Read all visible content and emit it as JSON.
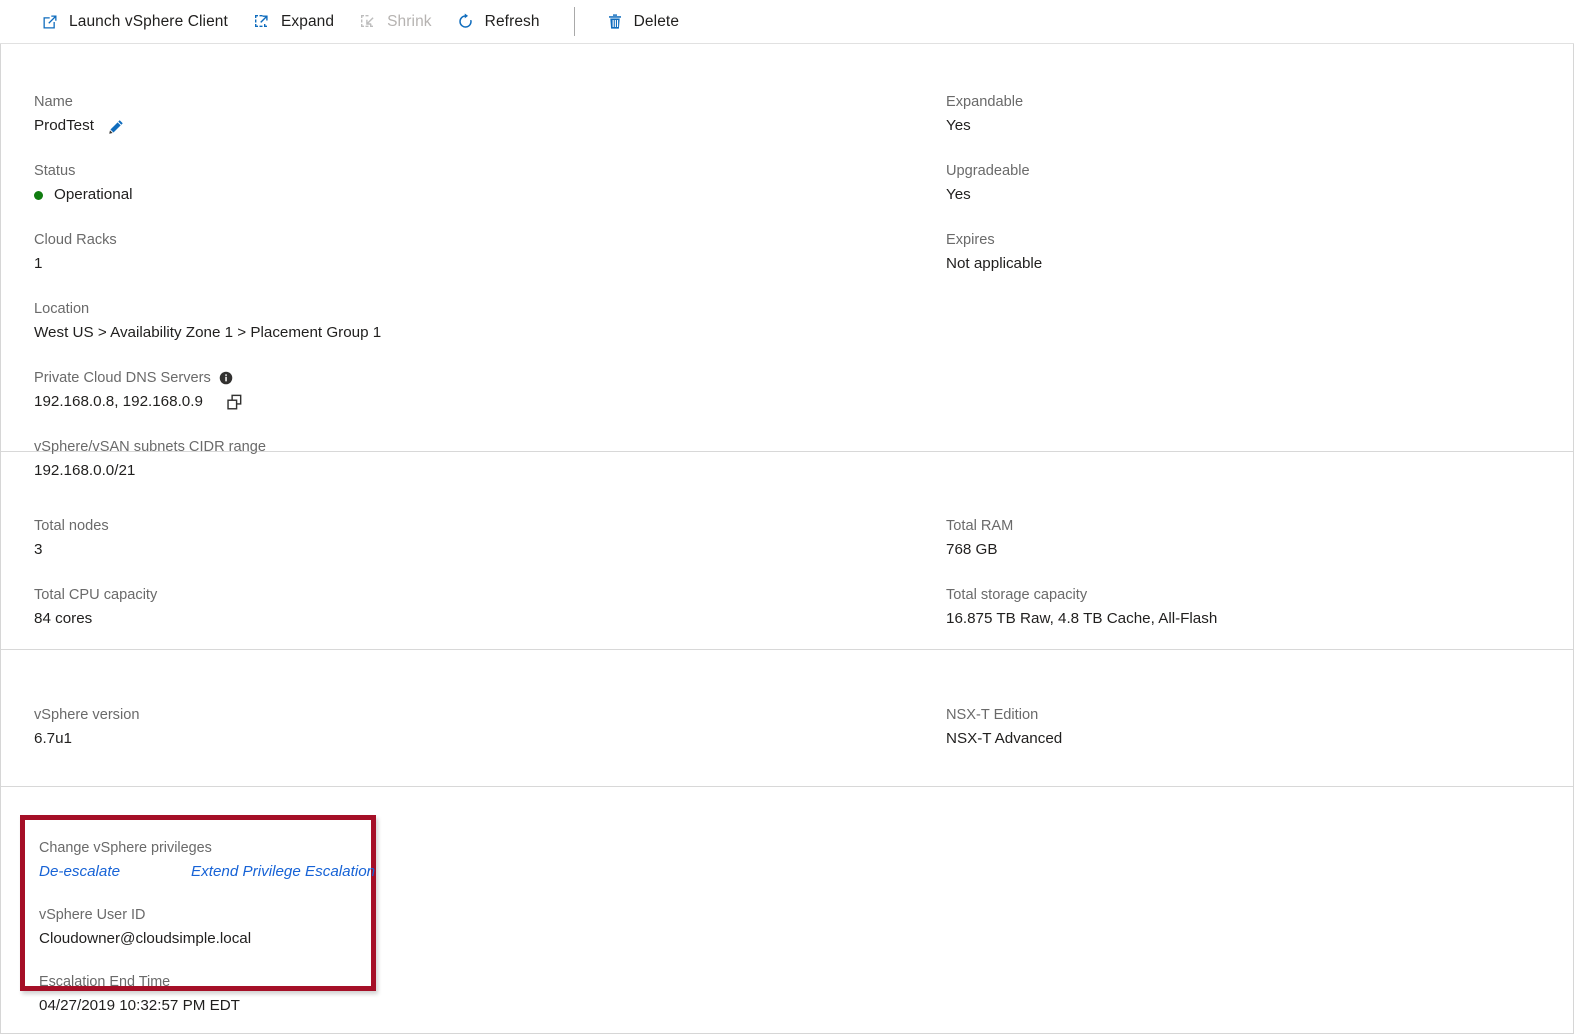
{
  "toolbar": {
    "buttons": [
      {
        "id": "launch-vsphere-client",
        "label": "Launch vSphere Client",
        "icon": "external-link-icon",
        "disabled": false
      },
      {
        "id": "expand",
        "label": "Expand",
        "icon": "expand-icon",
        "disabled": false
      },
      {
        "id": "shrink",
        "label": "Shrink",
        "icon": "shrink-icon",
        "disabled": true
      },
      {
        "id": "refresh",
        "label": "Refresh",
        "icon": "refresh-icon",
        "disabled": false
      },
      {
        "id": "delete",
        "label": "Delete",
        "icon": "trash-icon",
        "disabled": false
      }
    ]
  },
  "colors": {
    "accent": "#0f6cbd",
    "link": "#1763d6",
    "status_ok": "#107c10",
    "highlight_border": "#a50f27",
    "disabled_text": "#b6b3b1",
    "label_text": "#6a6a6a",
    "value_text": "#201f1e"
  },
  "overview": {
    "left": {
      "name": {
        "label": "Name",
        "value": "ProdTest"
      },
      "status": {
        "label": "Status",
        "value": "Operational"
      },
      "cloud_racks": {
        "label": "Cloud Racks",
        "value": "1"
      },
      "location": {
        "label": "Location",
        "value": "West US > Availability Zone 1 > Placement Group 1"
      },
      "dns_servers": {
        "label": "Private Cloud DNS Servers",
        "value": "192.168.0.8, 192.168.0.9"
      },
      "cidr_range": {
        "label": "vSphere/vSAN subnets CIDR range",
        "value": "192.168.0.0/21"
      }
    },
    "right": {
      "expandable": {
        "label": "Expandable",
        "value": "Yes"
      },
      "upgradeable": {
        "label": "Upgradeable",
        "value": "Yes"
      },
      "expires": {
        "label": "Expires",
        "value": "Not applicable"
      }
    }
  },
  "capacity": {
    "left": {
      "total_nodes": {
        "label": "Total nodes",
        "value": "3"
      },
      "total_cpu": {
        "label": "Total CPU capacity",
        "value": "84 cores"
      }
    },
    "right": {
      "total_ram": {
        "label": "Total RAM",
        "value": "768 GB"
      },
      "total_storage": {
        "label": "Total storage capacity",
        "value": "16.875 TB Raw, 4.8 TB Cache, All-Flash"
      }
    }
  },
  "software": {
    "left": {
      "vsphere_version": {
        "label": "vSphere version",
        "value": "6.7u1"
      }
    },
    "right": {
      "nsxt_edition": {
        "label": "NSX-T Edition",
        "value": "NSX-T Advanced"
      }
    }
  },
  "privileges": {
    "change_label": "Change vSphere privileges",
    "de_escalate_link": "De-escalate",
    "extend_link": "Extend Privilege Escalation",
    "user_id": {
      "label": "vSphere User ID",
      "value": "Cloudowner@cloudsimple.local"
    },
    "escalation_end": {
      "label": "Escalation End Time",
      "value": "04/27/2019 10:32:57 PM EDT"
    }
  }
}
